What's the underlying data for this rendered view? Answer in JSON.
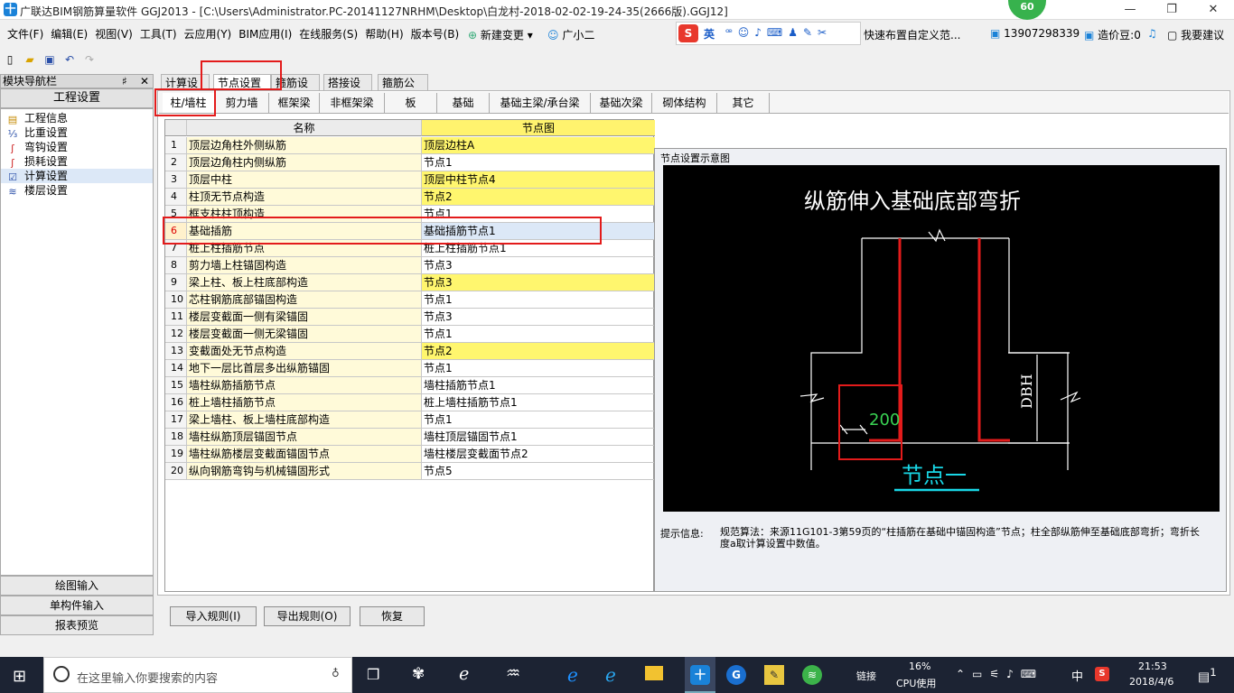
{
  "titlebar": {
    "title": "广联达BIM钢筋算量软件 GGJ2013 - [C:\\Users\\Administrator.PC-20141127NRHM\\Desktop\\白龙村-2018-02-02-19-24-35(2666版).GGJ12]",
    "badge": "60"
  },
  "menu": [
    "文件(F)",
    "编辑(E)",
    "视图(V)",
    "工具(T)",
    "云应用(Y)",
    "BIM应用(I)",
    "在线服务(S)",
    "帮助(H)",
    "版本号(B)"
  ],
  "menu_extra": {
    "new_change": "新建变更",
    "assistant": "广小二",
    "ime": "英",
    "promo": "快速布置自定义范...",
    "phone": "13907298339",
    "beans": "造价豆:0",
    "suggest": "我要建议"
  },
  "nav": {
    "header": "模块导航栏",
    "pin": "♯",
    "close": "✕",
    "title": "工程设置",
    "items": [
      {
        "label": "工程信息",
        "icon": "info-icon"
      },
      {
        "label": "比重设置",
        "icon": "weight-icon"
      },
      {
        "label": "弯钩设置",
        "icon": "hook-icon"
      },
      {
        "label": "损耗设置",
        "icon": "loss-icon"
      },
      {
        "label": "计算设置",
        "icon": "calc-icon"
      },
      {
        "label": "楼层设置",
        "icon": "floor-icon"
      }
    ],
    "bottom": [
      "绘图输入",
      "单构件输入",
      "报表预览"
    ]
  },
  "tabs_top": [
    "计算设置",
    "节点设置",
    "箍筋设置",
    "搭接设置",
    "箍筋公式"
  ],
  "tabs_sub": [
    "柱/墙柱",
    "剪力墙",
    "框架梁",
    "非框架梁",
    "板",
    "基础",
    "基础主梁/承台梁",
    "基础次梁",
    "砌体结构",
    "其它"
  ],
  "table": {
    "col_name": "名称",
    "col_node": "节点图",
    "rows": [
      {
        "n": "1",
        "name": "顶层边角柱外侧纵筋",
        "node": "顶层边柱A",
        "hl": true
      },
      {
        "n": "2",
        "name": "顶层边角柱内侧纵筋",
        "node": "节点1",
        "hl": false
      },
      {
        "n": "3",
        "name": "顶层中柱",
        "node": "顶层中柱节点4",
        "hl": true
      },
      {
        "n": "4",
        "name": "柱顶无节点构造",
        "node": "节点2",
        "hl": true
      },
      {
        "n": "5",
        "name": "框支柱柱顶构造",
        "node": "节点1",
        "hl": false
      },
      {
        "n": "6",
        "name": "基础插筋",
        "node": "基础插筋节点1",
        "hl": false
      },
      {
        "n": "7",
        "name": "桩上柱插筋节点",
        "node": "桩上柱插筋节点1",
        "hl": false
      },
      {
        "n": "8",
        "name": "剪力墙上柱锚固构造",
        "node": "节点3",
        "hl": false
      },
      {
        "n": "9",
        "name": "梁上柱、板上柱底部构造",
        "node": "节点3",
        "hl": true
      },
      {
        "n": "10",
        "name": "芯柱钢筋底部锚固构造",
        "node": "节点1",
        "hl": false
      },
      {
        "n": "11",
        "name": "楼层变截面一侧有梁锚固",
        "node": "节点3",
        "hl": false
      },
      {
        "n": "12",
        "name": "楼层变截面一侧无梁锚固",
        "node": "节点1",
        "hl": false
      },
      {
        "n": "13",
        "name": "变截面处无节点构造",
        "node": "节点2",
        "hl": true
      },
      {
        "n": "14",
        "name": "地下一层比首层多出纵筋锚固",
        "node": "节点1",
        "hl": false
      },
      {
        "n": "15",
        "name": "墙柱纵筋插筋节点",
        "node": "墙柱插筋节点1",
        "hl": false
      },
      {
        "n": "16",
        "name": "桩上墙柱插筋节点",
        "node": "桩上墙柱插筋节点1",
        "hl": false
      },
      {
        "n": "17",
        "name": "梁上墙柱、板上墙柱底部构造",
        "node": "节点1",
        "hl": false
      },
      {
        "n": "18",
        "name": "墙柱纵筋顶层锚固节点",
        "node": "墙柱顶层锚固节点1",
        "hl": false
      },
      {
        "n": "19",
        "name": "墙柱纵筋楼层变截面锚固节点",
        "node": "墙柱楼层变截面节点2",
        "hl": false
      },
      {
        "n": "20",
        "name": "纵向钢筋弯钩与机械锚固形式",
        "node": "节点5",
        "hl": false
      }
    ]
  },
  "panel": {
    "title": "节点设置示意图",
    "diagram_title": "纵筋伸入基础底部弯折",
    "dim_200": "200",
    "dim_dbh": "DBH",
    "node_label": "节点一",
    "hint_label": "提示信息:",
    "hint": "规范算法：来源11G101-3第59页的“柱插筋在基础中锚固构造”节点；柱全部纵筋伸至基础底部弯折；弯折长度a取计算设置中数值。"
  },
  "buttons": [
    "导入规则(I)",
    "导出规则(O)",
    "恢复"
  ],
  "taskbar": {
    "search": "在这里输入你要搜索的内容",
    "net": "链接",
    "cpu": "16%",
    "cpu_label": "CPU使用",
    "lang": "中",
    "time": "21:53",
    "date": "2018/4/6",
    "notif": "1"
  },
  "colors": {
    "highlight_red": "#e31b1b",
    "row_yellow": "#fff66e",
    "diagram_bg": "#000000",
    "rebar_red": "#e31b1b",
    "dim_green": "#39d353",
    "label_cyan": "#19d7e6"
  }
}
